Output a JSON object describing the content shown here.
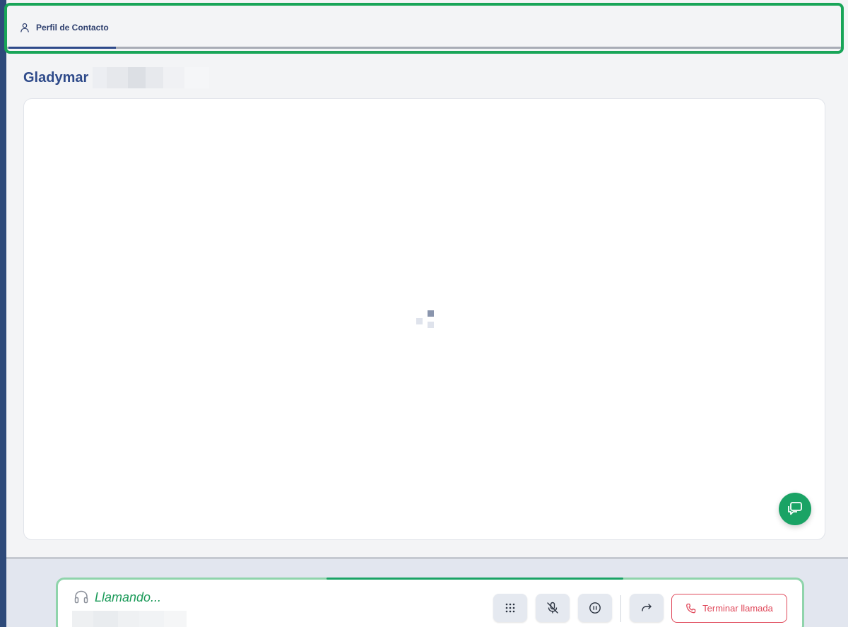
{
  "tabs": [
    {
      "label": "Perfil de Contacto",
      "icon": "user-icon",
      "active": true
    }
  ],
  "contact": {
    "first_name": "Gladymar",
    "last_name_redacted": true
  },
  "content": {
    "state": "loading",
    "loader_icon": "loading-spinner-icon"
  },
  "chat_fab": {
    "icon": "chat-bubbles-icon"
  },
  "call": {
    "status_icon": "headset-icon",
    "status_text": "Llamando...",
    "number_redacted": true,
    "controls": [
      {
        "name": "keypad-button",
        "icon": "keypad-icon"
      },
      {
        "name": "mute-button",
        "icon": "microphone-off-icon"
      },
      {
        "name": "hold-button",
        "icon": "pause-icon"
      },
      {
        "name": "transfer-button",
        "icon": "forward-arrow-icon"
      }
    ],
    "end_call_label": "Terminar llamada",
    "end_call_icon": "phone-icon"
  },
  "colors": {
    "brand_navy": "#2e4a8a",
    "success_green": "#1aa365",
    "danger_red": "#e0485a"
  }
}
